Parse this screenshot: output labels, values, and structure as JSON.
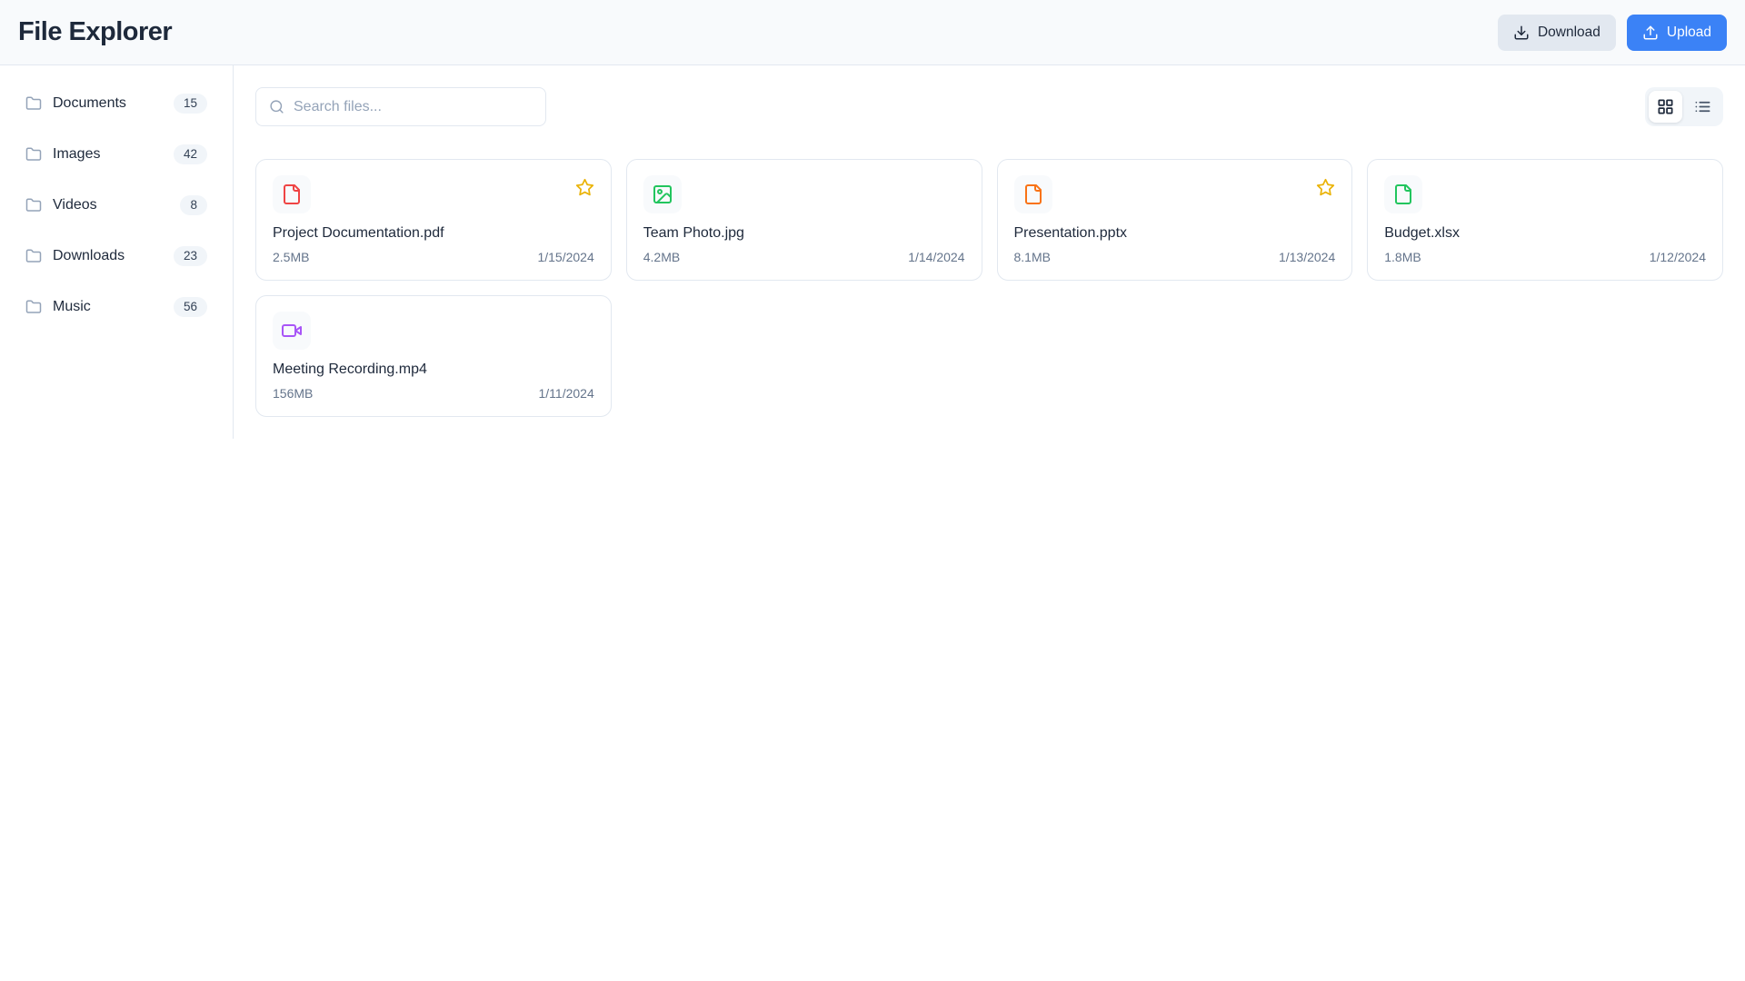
{
  "app": {
    "title": "File Explorer"
  },
  "header": {
    "download_label": "Download",
    "upload_label": "Upload"
  },
  "sidebar": {
    "items": [
      {
        "label": "Documents",
        "count": "15"
      },
      {
        "label": "Images",
        "count": "42"
      },
      {
        "label": "Videos",
        "count": "8"
      },
      {
        "label": "Downloads",
        "count": "23"
      },
      {
        "label": "Music",
        "count": "56"
      }
    ]
  },
  "toolbar": {
    "search_placeholder": "Search files...",
    "search_value": "",
    "active_view": "grid"
  },
  "files": [
    {
      "name": "Project Documentation.pdf",
      "size": "2.5MB",
      "date": "1/15/2024",
      "icon": "file",
      "color": "#ef4444",
      "starred": true
    },
    {
      "name": "Team Photo.jpg",
      "size": "4.2MB",
      "date": "1/14/2024",
      "icon": "image",
      "color": "#22c55e",
      "starred": false
    },
    {
      "name": "Presentation.pptx",
      "size": "8.1MB",
      "date": "1/13/2024",
      "icon": "file",
      "color": "#f97316",
      "starred": true
    },
    {
      "name": "Budget.xlsx",
      "size": "1.8MB",
      "date": "1/12/2024",
      "icon": "file",
      "color": "#22c55e",
      "starred": false
    },
    {
      "name": "Meeting Recording.mp4",
      "size": "156MB",
      "date": "1/11/2024",
      "icon": "video",
      "color": "#a855f7",
      "starred": false
    }
  ],
  "colors": {
    "accent": "#3b82f6",
    "star": "#eab308",
    "pdf": "#ef4444",
    "jpg": "#22c55e",
    "pptx": "#f97316",
    "xlsx": "#22c55e",
    "mp4": "#a855f7",
    "border": "#e2e8f0",
    "header_bg": "#f8fafc"
  }
}
